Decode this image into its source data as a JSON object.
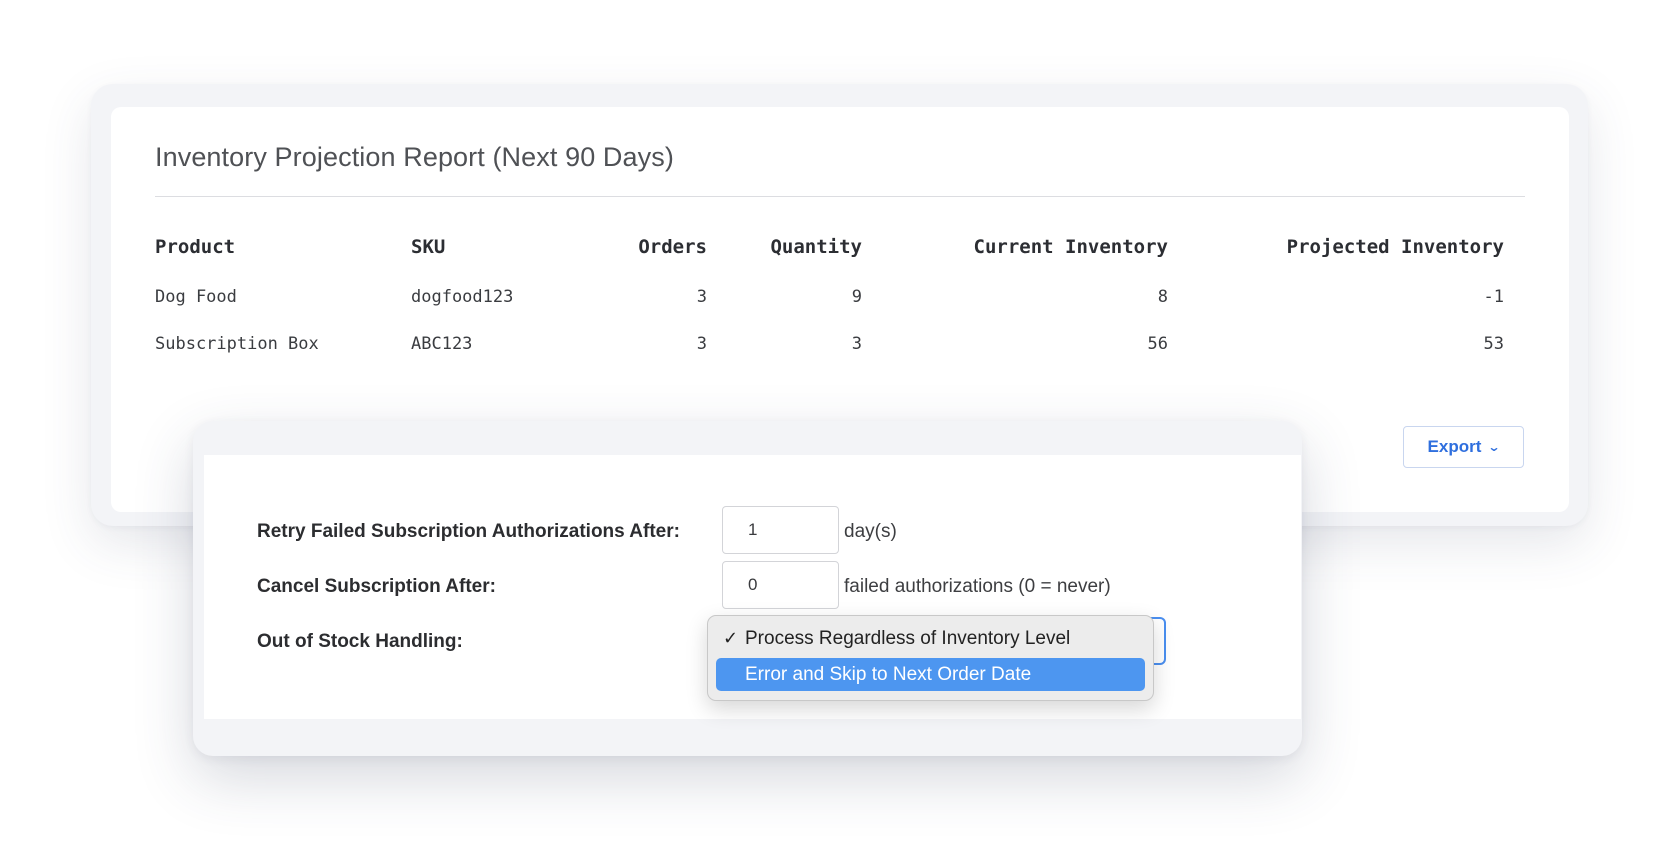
{
  "report": {
    "title": "Inventory Projection Report (Next 90 Days)",
    "columns": [
      "Product",
      "SKU",
      "Orders",
      "Quantity",
      "Current Inventory",
      "Projected Inventory"
    ],
    "rows": [
      {
        "product": "Dog Food",
        "sku": "dogfood123",
        "orders": "3",
        "quantity": "9",
        "current_inventory": "8",
        "projected_inventory": "-1"
      },
      {
        "product": "Subscription Box",
        "sku": "ABC123",
        "orders": "3",
        "quantity": "3",
        "current_inventory": "56",
        "projected_inventory": "53"
      }
    ],
    "export_label": "Export",
    "export_icon": "chevron-down-icon"
  },
  "settings": {
    "retry": {
      "label": "Retry Failed Subscription Authorizations After:",
      "value": "1",
      "suffix": "day(s)"
    },
    "cancel": {
      "label": "Cancel Subscription After:",
      "value": "0",
      "suffix": "failed authorizations (0 = never)"
    },
    "stock": {
      "label": "Out of Stock Handling:",
      "options": [
        {
          "label": "Process Regardless of Inventory Level",
          "checked": true
        },
        {
          "label": "Error and Skip to Next Order Date",
          "highlighted": true
        }
      ],
      "check_glyph": "✓"
    }
  },
  "colors": {
    "accent": "#2f6fde",
    "highlight": "#4d96f0",
    "focus_border": "#4a8ff0"
  }
}
